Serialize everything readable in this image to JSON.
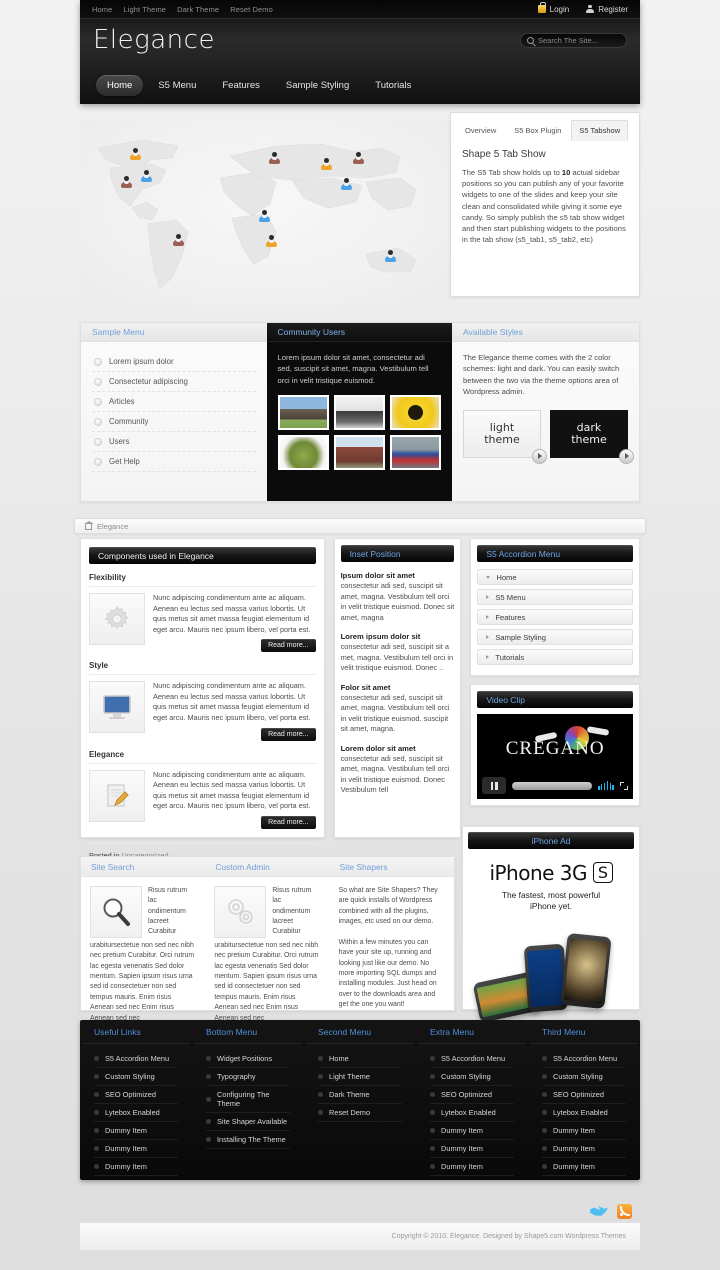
{
  "topbar": {
    "links": [
      "Home",
      "Light Theme",
      "Dark Theme",
      "Reset Demo"
    ],
    "login": "Login",
    "register": "Register"
  },
  "brand": {
    "logo": "Elegance"
  },
  "search": {
    "placeholder": "Search The Site...",
    "value": ""
  },
  "nav": {
    "items": [
      "Home",
      "S5 Menu",
      "Features",
      "Sample Styling",
      "Tutorials"
    ],
    "active": "Home"
  },
  "tabshow": {
    "tabs": [
      "Overview",
      "S5 Box Plugin",
      "S5 Tabshow"
    ],
    "active": "S5 Tabshow",
    "heading": "Shape 5 Tab Show",
    "body_before": "The S5 Tab show holds up to ",
    "body_bold": "10",
    "body_after": " actual sidebar positions so you can publish any of your favorite widgets to one of the slides and keep your site clean and consolidated while giving it some eye candy. So simply publish the s5 tab show widget and then start publishing widgets to the positions in the tab show (s5_tab1, s5_tab2, etc)"
  },
  "features": {
    "sample_menu": {
      "title": "Sample Menu",
      "items": [
        "Lorem ipsum dolor",
        "Consectetur adipiscing",
        "Articles",
        "Community",
        "Users",
        "Get Help"
      ]
    },
    "community": {
      "title": "Community Users",
      "text": "Lorem ipsum dolor sit amet, consectetur adi sed, suscipit sit amet, magna. Vestibulum tell orci in velit tristique euismod.",
      "thumbs": [
        "cow-photo",
        "pickup-truck-photo",
        "sunflower-photo",
        "frog-photo",
        "brick-building-photo",
        "motorcycle-racing-photo"
      ]
    },
    "styles": {
      "title": "Available Styles",
      "text": "The Elegance theme comes with the 2 color schemes: light and dark. You can easily switch between the two via the theme options area of Wordpress admin.",
      "shots": [
        {
          "line1": "light",
          "line2": "theme"
        },
        {
          "line1": "dark",
          "line2": "theme"
        }
      ]
    }
  },
  "breadcrumb": {
    "text": "Elegance"
  },
  "content": {
    "title": "Components used in Elegance",
    "articles": [
      {
        "heading": "Flexibility",
        "icon": "gear-icon",
        "text": "Nunc adipiscing condimentum ante ac aliquam. Aenean eu lectus sed massa varius lobortis. Ut quis metus sit amet massa feugiat elementum id eget arcu. Mauris nec ipsum libero, vel porta est.",
        "read_more": "Read more..."
      },
      {
        "heading": "Style",
        "icon": "monitor-icon",
        "text": "Nunc adipiscing condimentum ante ac aliquam. Aenean eu lectus sed massa varius lobortis. Ut quis metus sit amet massa feugiat elementum id eget arcu. Mauris nec ipsum libero, vel porta est.",
        "read_more": "Read more..."
      },
      {
        "heading": "Elegance",
        "icon": "pencil-document-icon",
        "text": "Nunc adipiscing condimentum ante ac aliquam. Aenean eu lectus sed massa varius lobortis. Ut quis metus sit amet massa feugiat elementum id eget arcu. Mauris nec ipsum libero, vel porta est.",
        "read_more": "Read more..."
      }
    ],
    "posted_label": "Posted in",
    "posted_category": "Uncategorized"
  },
  "inset": {
    "title": "Inset Position",
    "items": [
      {
        "heading": "Ipsum dolor sit amet",
        "text": "consectetur adi sed, suscipit sit amet, magna. Vestibulum tell orci in velit tristique euismod. Donec sit amet, magna"
      },
      {
        "heading": "Lorem ipsum dolor sit",
        "text": "consectetur adi sed, suscipit sit a met, magna. Vestibulum tell orci in velit tristique euismod. Donec .."
      },
      {
        "heading": "Folor sit amet",
        "text": "consectetur adi sed, suscipit sit amet, magna. Vestibulum tell orci in velit tristique euismod. suscipit sit amet, magna."
      },
      {
        "heading": "Lorem dolor sit amet",
        "text": "consectetur adi sed, suscipit sit amet, magna. Vestibulum tell orci in velit tristique euismod. Donec Vestibulum tell"
      }
    ]
  },
  "accordion": {
    "title": "S5 Accordion Menu",
    "items": [
      {
        "label": "Home",
        "expanded": true
      },
      {
        "label": "S5 Menu",
        "expanded": false
      },
      {
        "label": "Features",
        "expanded": false
      },
      {
        "label": "Sample Styling",
        "expanded": false
      },
      {
        "label": "Tutorials",
        "expanded": false
      }
    ]
  },
  "video": {
    "title": "Video Clip",
    "brand": "CREGANO"
  },
  "ad": {
    "title": "iPhone Ad",
    "headline": "iPhone 3G",
    "badge": "S",
    "tagline_line1": "The fastest, most powerful",
    "tagline_line2": "iPhone yet."
  },
  "bottom": [
    {
      "title": "Site Search",
      "icon": "magnifier-icon",
      "text": "Risus rutrum lac ondimentum lacreet Curabitur urabitursectetue non sed nec nibh nec pretium Curabitur. Orci rutrum lac egesta venenatis Sed dolor mentum. Sapien ipsum risus urna sed id consectetuer non sed tempus mauris. Enim risus Aenean sed nec Enim risus Aenean sed nec"
    },
    {
      "title": "Custom Admin",
      "icon": "gears-icon",
      "text": "Risus rutrum lac ondimentum lacreet Curabitur urabitursectetue non sed nec nibh nec pretium Curabitur. Orci rutrum lac egesta venenatis Sed dolor mentum. Sapien ipsum risus urna sed id consectetuer non sed tempus mauris. Enim risus Aenean sed nec Enim risus Aenean sed nec"
    },
    {
      "title": "Site Shapers",
      "icon": "",
      "text": "So what are Site Shapers? They are quick installs of Wordpress combined with all the plugins, images, etc used on our demo.\n\nWithin a few minutes you can have your site up, running and looking just like our demo. No more importing SQL dumps and installing modules. Just head on over to the downloads area and get the one you want!"
    }
  ],
  "footer_menus": [
    {
      "title": "Useful Links",
      "items": [
        "S5 Accordion Menu",
        "Custom Styling",
        "SEO Optimized",
        "Lytebox Enabled",
        "Dummy Item",
        "Dummy Item",
        "Dummy Item"
      ]
    },
    {
      "title": "Bottom Menu",
      "items": [
        "Widget Positions",
        "Typography",
        "Configuring The Theme",
        "Site Shaper Available",
        "Installing The Theme"
      ]
    },
    {
      "title": "Second Menu",
      "items": [
        "Home",
        "Light Theme",
        "Dark Theme",
        "Reset Demo"
      ]
    },
    {
      "title": "Extra Menu",
      "items": [
        "S5 Accordion Menu",
        "Custom Styling",
        "SEO Optimized",
        "Lytebox Enabled",
        "Dummy Item",
        "Dummy Item",
        "Dummy Item"
      ]
    },
    {
      "title": "Third Menu",
      "items": [
        "S5 Accordion Menu",
        "Custom Styling",
        "SEO Optimized",
        "Lytebox Enabled",
        "Dummy Item",
        "Dummy Item",
        "Dummy Item"
      ]
    }
  ],
  "social": [
    "twitter-icon",
    "rss-icon"
  ],
  "copyright": "Copyright © 2010. Elegance. Designed by Shape5.com Wordpress Themes",
  "colors": {
    "accent": "#6f9fd8",
    "dark": "#0b0b0b",
    "page_bg": "#e8e8e8"
  }
}
